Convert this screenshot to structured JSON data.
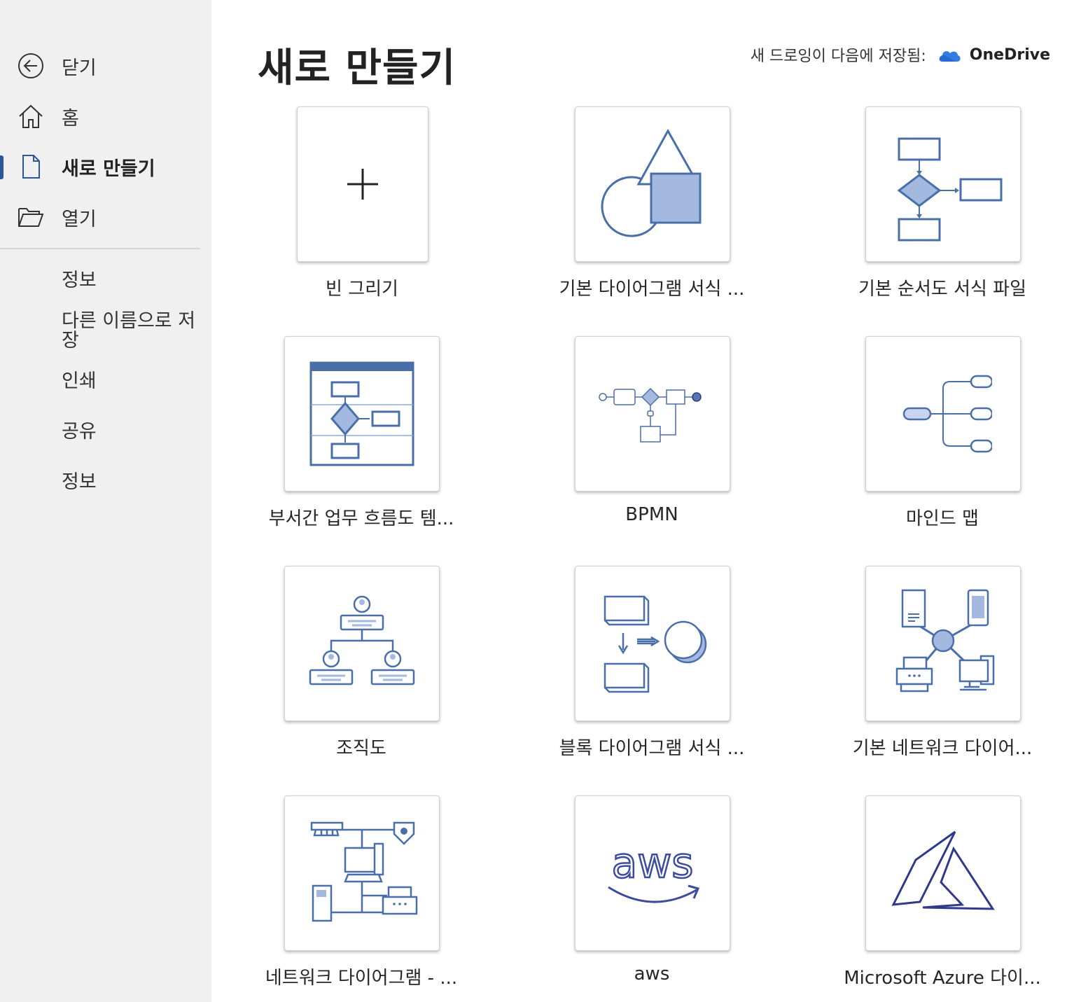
{
  "nav": {
    "back_label": "닫기",
    "home_label": "홈",
    "new_label": "새로 만들기",
    "open_label": "열기"
  },
  "sub_nav": {
    "info": "정보",
    "save_as": "다른 이름으로 저장",
    "print": "인쇄",
    "share": "공유",
    "about": "정보"
  },
  "header": {
    "title": "새로 만들기",
    "save_text": "새 드로잉이 다음에 저장됨:",
    "storage_name": "OneDrive"
  },
  "templates": [
    {
      "label": "빈 그리기",
      "icon": "plus-icon"
    },
    {
      "label": "기본 다이어그램 서식 ...",
      "icon": "basic-shapes-icon"
    },
    {
      "label": "기본 순서도 서식 파일",
      "icon": "flowchart-icon"
    },
    {
      "label": "부서간 업무 흐름도 템...",
      "icon": "swimlane-icon"
    },
    {
      "label": "BPMN",
      "icon": "bpmn-icon"
    },
    {
      "label": "마인드 맵",
      "icon": "mind-map-icon"
    },
    {
      "label": "조직도",
      "icon": "org-chart-icon"
    },
    {
      "label": "블록 다이어그램 서식 ...",
      "icon": "block-diagram-icon"
    },
    {
      "label": "기본 네트워크 다이어...",
      "icon": "basic-network-icon"
    },
    {
      "label": "네트워크 다이어그램 - ...",
      "icon": "network-diagram-icon"
    },
    {
      "label": "aws",
      "icon": "aws-logo-icon"
    },
    {
      "label": "Microsoft Azure 다이...",
      "icon": "azure-logo-icon"
    }
  ],
  "colors": {
    "accent": "#2b579a",
    "diagram_stroke": "#4a6fa8",
    "diagram_fill": "#a3b9e0",
    "sidebar_bg": "#f0f0f0"
  }
}
